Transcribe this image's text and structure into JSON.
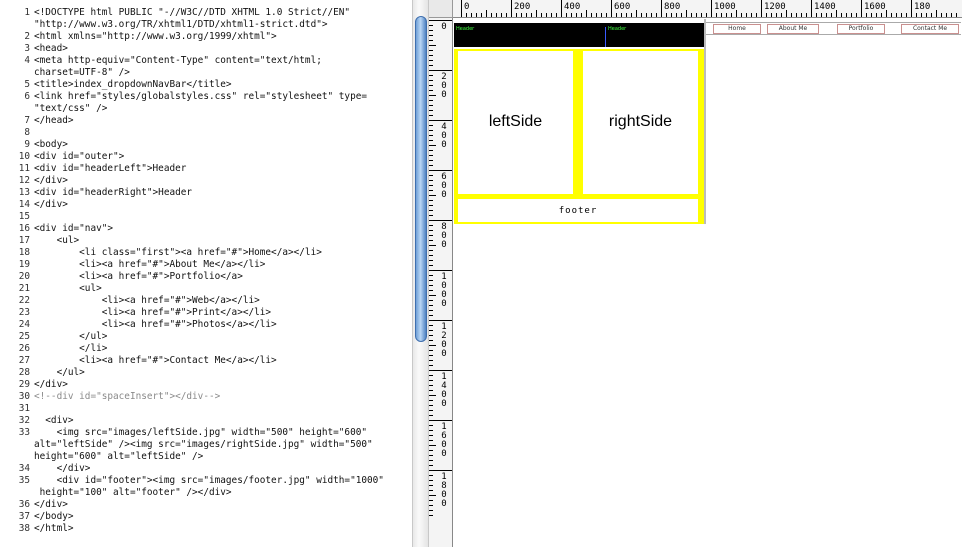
{
  "editor": {
    "lines": [
      {
        "n": "1",
        "t": "<!DOCTYPE html PUBLIC \"-//W3C//DTD XHTML 1.0 Strict//EN\""
      },
      {
        "n": "",
        "t": "\"http://www.w3.org/TR/xhtml1/DTD/xhtml1-strict.dtd\">"
      },
      {
        "n": "2",
        "t": "<html xmlns=\"http://www.w3.org/1999/xhtml\">"
      },
      {
        "n": "3",
        "t": "<head>"
      },
      {
        "n": "4",
        "t": "<meta http-equiv=\"Content-Type\" content=\"text/html;"
      },
      {
        "n": "",
        "t": "charset=UTF-8\" />"
      },
      {
        "n": "5",
        "t": "<title>index_dropdownNavBar</title>"
      },
      {
        "n": "6",
        "t": "<link href=\"styles/globalstyles.css\" rel=\"stylesheet\" type="
      },
      {
        "n": "",
        "t": "\"text/css\" />"
      },
      {
        "n": "7",
        "t": "</head>"
      },
      {
        "n": "8",
        "t": ""
      },
      {
        "n": "9",
        "t": "<body>"
      },
      {
        "n": "10",
        "t": "<div id=\"outer\">"
      },
      {
        "n": "11",
        "t": "<div id=\"headerLeft\">Header"
      },
      {
        "n": "12",
        "t": "</div>"
      },
      {
        "n": "13",
        "t": "<div id=\"headerRight\">Header"
      },
      {
        "n": "14",
        "t": "</div>"
      },
      {
        "n": "15",
        "t": ""
      },
      {
        "n": "16",
        "t": "<div id=\"nav\">"
      },
      {
        "n": "17",
        "t": "    <ul>"
      },
      {
        "n": "18",
        "t": "        <li class=\"first\"><a href=\"#\">Home</a></li>"
      },
      {
        "n": "19",
        "t": "        <li><a href=\"#\">About Me</a></li>"
      },
      {
        "n": "20",
        "t": "        <li><a href=\"#\">Portfolio</a>"
      },
      {
        "n": "21",
        "t": "        <ul>"
      },
      {
        "n": "22",
        "t": "            <li><a href=\"#\">Web</a></li>"
      },
      {
        "n": "23",
        "t": "            <li><a href=\"#\">Print</a></li>"
      },
      {
        "n": "24",
        "t": "            <li><a href=\"#\">Photos</a></li>"
      },
      {
        "n": "25",
        "t": "        </ul>"
      },
      {
        "n": "26",
        "t": "        </li>"
      },
      {
        "n": "27",
        "t": "        <li><a href=\"#\">Contact Me</a></li>"
      },
      {
        "n": "28",
        "t": "    </ul>"
      },
      {
        "n": "29",
        "t": "</div>"
      },
      {
        "n": "30",
        "t": "<!--div id=\"spaceInsert\"></div-->"
      },
      {
        "n": "31",
        "t": ""
      },
      {
        "n": "32",
        "t": "  <div>"
      },
      {
        "n": "33",
        "t": "    <img src=\"images/leftSide.jpg\" width=\"500\" height=\"600\""
      },
      {
        "n": "",
        "t": "alt=\"leftSide\" /><img src=\"images/rightSide.jpg\" width=\"500\""
      },
      {
        "n": "",
        "t": "height=\"600\" alt=\"leftSide\" />"
      },
      {
        "n": "34",
        "t": "    </div>"
      },
      {
        "n": "35",
        "t": "    <div id=\"footer\"><img src=\"images/footer.jpg\" width=\"1000\""
      },
      {
        "n": "",
        "t": " height=\"100\" alt=\"footer\" /></div>"
      },
      {
        "n": "36",
        "t": "</div>"
      },
      {
        "n": "37",
        "t": "</body>"
      },
      {
        "n": "38",
        "t": "</html>"
      }
    ]
  },
  "ruler": {
    "top": [
      "0",
      "200",
      "400",
      "600",
      "800",
      "1000",
      "1200",
      "1400",
      "1600",
      "180"
    ],
    "left": [
      "0",
      "200",
      "400",
      "600",
      "800",
      "1000",
      "1200",
      "1400",
      "1600",
      "1800"
    ]
  },
  "preview": {
    "header_left": "Header",
    "header_right": "Header",
    "nav": [
      "Home",
      "About Me",
      "Portfolio",
      "Contact Me"
    ],
    "left_side": "leftSide",
    "right_side": "rightSide",
    "footer": "footer"
  }
}
